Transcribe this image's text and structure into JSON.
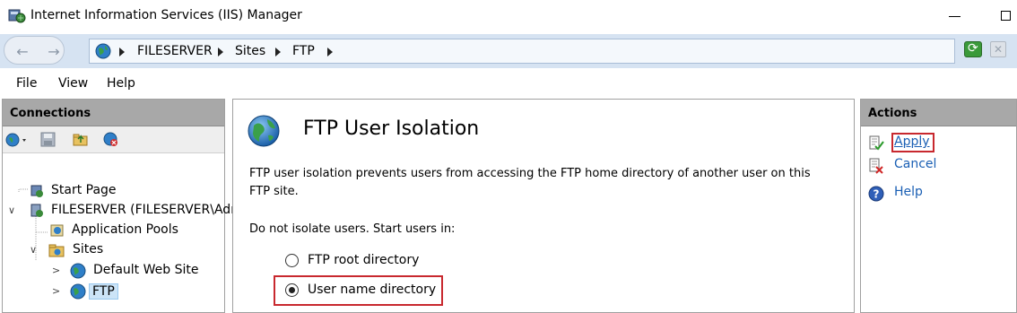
{
  "window": {
    "title": "Internet Information Services (IIS) Manager"
  },
  "address_bar": {
    "crumbs": [
      "FILESERVER",
      "Sites",
      "FTP"
    ]
  },
  "menu": {
    "items": [
      "File",
      "View",
      "Help"
    ]
  },
  "connections": {
    "header": "Connections",
    "tree": [
      {
        "label": "Start Page"
      },
      {
        "label": "FILESERVER (FILESERVER\\Adm"
      },
      {
        "label": "Application Pools"
      },
      {
        "label": "Sites"
      },
      {
        "label": "Default Web Site"
      },
      {
        "label": "FTP"
      }
    ]
  },
  "feature": {
    "title": "FTP User Isolation",
    "description": "FTP user isolation prevents users from accessing the FTP home directory of another user on this FTP site.",
    "group_label": "Do not isolate users. Start users in:",
    "options": [
      {
        "label": "FTP root directory",
        "checked": false
      },
      {
        "label": "User name directory",
        "checked": true
      }
    ]
  },
  "actions": {
    "header": "Actions",
    "items": [
      {
        "label": "Apply",
        "icon": "apply-icon"
      },
      {
        "label": "Cancel",
        "icon": "cancel-icon"
      },
      {
        "label": "Help",
        "icon": "help-icon"
      }
    ]
  },
  "colors": {
    "highlight": "#c8282e",
    "link": "#1a5fb4",
    "panel_header": "#a8a8a8",
    "address_bar": "#d6e3f2"
  }
}
